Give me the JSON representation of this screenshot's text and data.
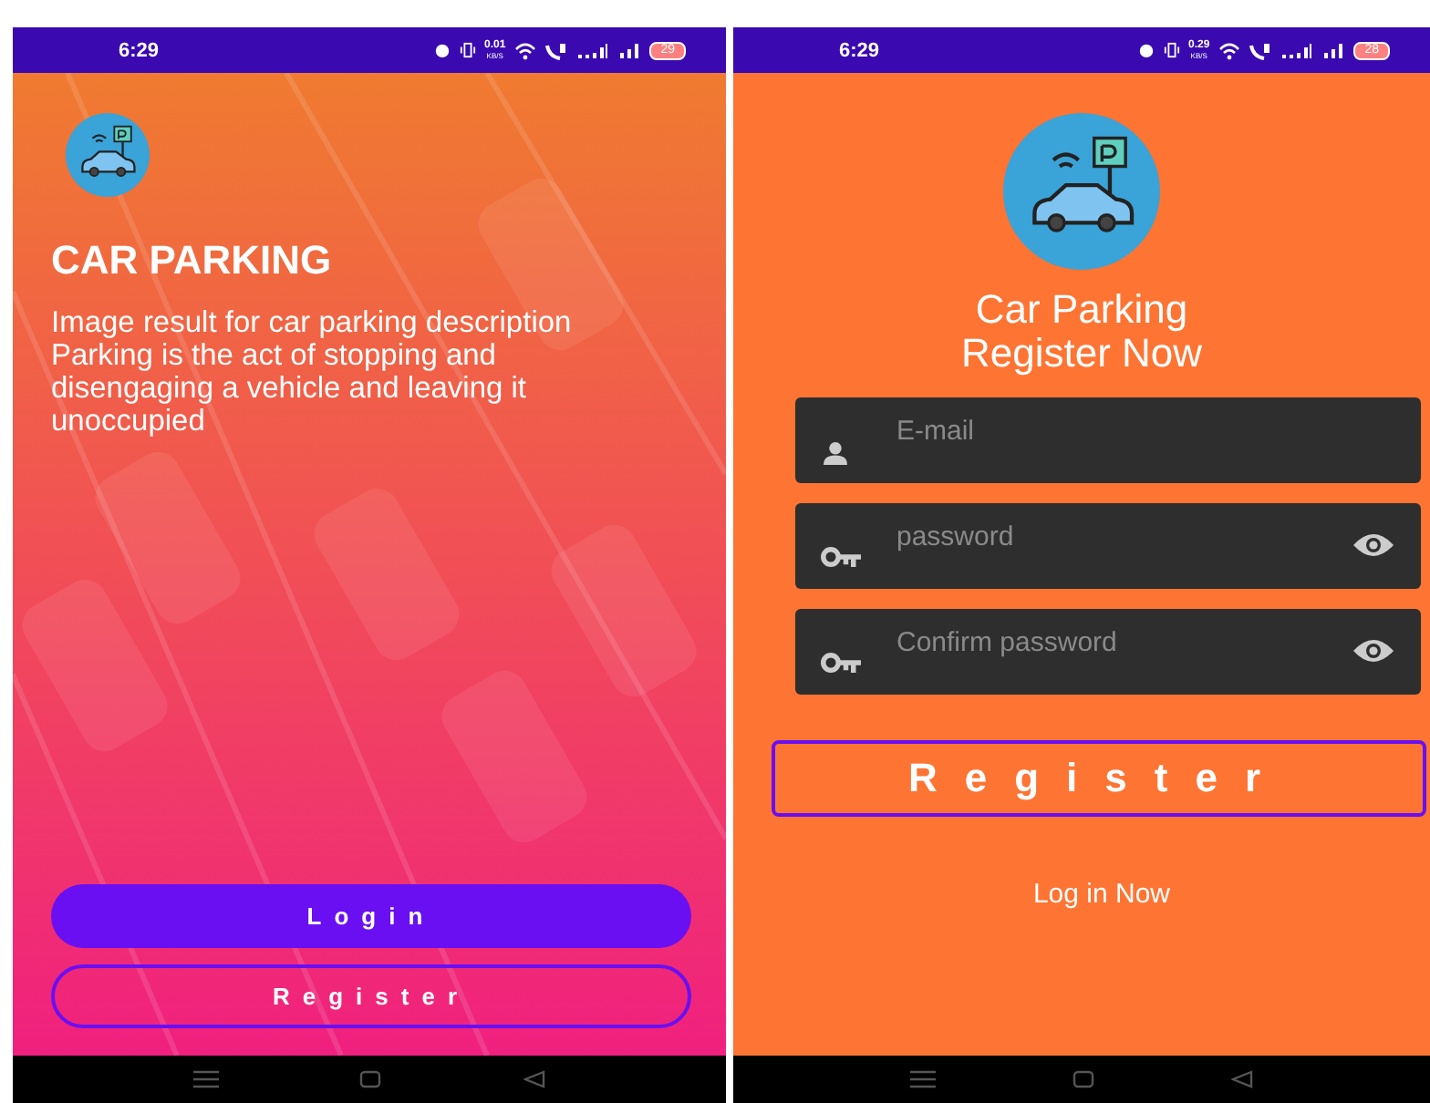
{
  "screens": [
    {
      "kind": "welcome",
      "status_bar": {
        "time": "6:29",
        "speed": "0.01",
        "speed_unit": "KB/S",
        "battery": "29"
      },
      "title": "CAR PARKING",
      "description": "Image result for car parking description Parking is the act of stopping and disengaging a vehicle and leaving it unoccupied",
      "buttons": [
        {
          "label": "Login",
          "kind": "filled"
        },
        {
          "label": "Register",
          "kind": "outlined"
        }
      ]
    },
    {
      "kind": "register",
      "status_bar": {
        "time": "6:29",
        "speed": "0.29",
        "speed_unit": "KB/S",
        "battery": "28"
      },
      "title": "Car Parking\nRegister Now",
      "fields": [
        {
          "placeholder": "E-mail",
          "kind": "email"
        },
        {
          "placeholder": "password",
          "kind": "password"
        },
        {
          "placeholder": "Confirm password",
          "kind": "password"
        }
      ],
      "buttons": [
        {
          "label": "Register",
          "kind": "outlined"
        }
      ],
      "link": "Log in Now"
    }
  ]
}
